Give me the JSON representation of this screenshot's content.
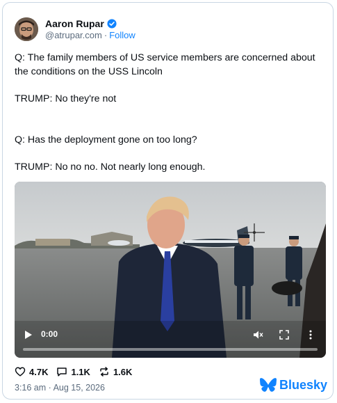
{
  "author": {
    "display_name": "Aaron Rupar",
    "handle": "@atrupar.com",
    "separator": "·",
    "follow_label": "Follow"
  },
  "post": {
    "paragraphs": [
      "Q: The family members of US service members are concerned about the conditions on the USS Lincoln",
      "TRUMP: No they're not",
      "Q: Has the deployment gone on too long?",
      "TRUMP: No no no. Not nearly long enough."
    ]
  },
  "video": {
    "time": "0:00",
    "progress": 0
  },
  "stats": {
    "likes": "4.7K",
    "replies": "1.1K",
    "reposts": "1.6K"
  },
  "timestamp": "3:16 am · Aug 15, 2026",
  "brand": {
    "name": "Bluesky",
    "color": "#1083fe"
  },
  "icons": {
    "verified": "verified-check-icon",
    "like": "heart-icon",
    "reply": "speech-bubble-icon",
    "repost": "repost-arrows-icon",
    "play": "play-icon",
    "mute": "speaker-muted-icon",
    "fullscreen": "fullscreen-icon",
    "more": "more-dots-icon",
    "brand": "butterfly-icon"
  }
}
